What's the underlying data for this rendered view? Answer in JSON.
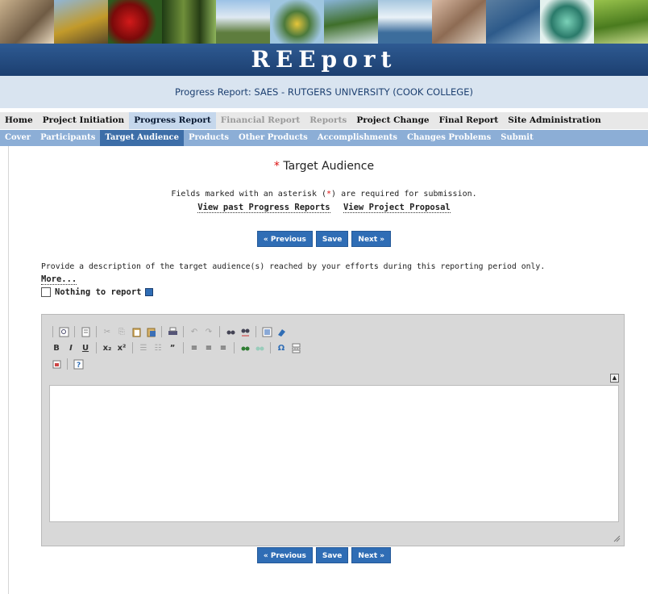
{
  "site": {
    "brand": "REEport",
    "subtitle": "Progress Report: SAES - RUTGERS UNIVERSITY (COOK COLLEGE)"
  },
  "nav": {
    "tabs": [
      {
        "label": "Home",
        "state": "normal"
      },
      {
        "label": "Project Initiation",
        "state": "normal"
      },
      {
        "label": "Progress Report",
        "state": "active"
      },
      {
        "label": "Financial Report",
        "state": "disabled"
      },
      {
        "label": "Reports",
        "state": "disabled"
      },
      {
        "label": "Project Change",
        "state": "normal"
      },
      {
        "label": "Final Report",
        "state": "normal"
      },
      {
        "label": "Site Administration",
        "state": "normal"
      }
    ],
    "subtabs": [
      {
        "label": "Cover",
        "state": "normal"
      },
      {
        "label": "Participants",
        "state": "normal"
      },
      {
        "label": "Target Audience",
        "state": "active"
      },
      {
        "label": "Products",
        "state": "normal"
      },
      {
        "label": "Other Products",
        "state": "normal"
      },
      {
        "label": "Accomplishments",
        "state": "normal"
      },
      {
        "label": "Changes Problems",
        "state": "normal"
      },
      {
        "label": "Submit",
        "state": "normal"
      }
    ]
  },
  "page": {
    "required_mark": "*",
    "title": "Target Audience",
    "note_prefix": "Fields marked with an asterisk (",
    "note_mark": "*",
    "note_suffix": ") are required for submission.",
    "link_past": "View past Progress Reports",
    "link_proposal": "View Project Proposal",
    "btn_previous": "« Previous",
    "btn_save": "Save",
    "btn_next": "Next »",
    "description": "Provide a description of the target audience(s) reached by your efforts during this reporting period only.",
    "more_label": "More...",
    "nothing_label": "Nothing to report",
    "nothing_checked": false
  },
  "editor": {
    "toolbar_row1": [
      "source-icon",
      "preview-icon",
      "cut-icon",
      "copy-icon",
      "paste-icon",
      "paste-word-icon",
      "print-icon",
      "undo-icon",
      "redo-icon",
      "find-icon",
      "replace-icon",
      "select-all-icon",
      "remove-format-icon"
    ],
    "toolbar_row2": [
      "bold-icon",
      "italic-icon",
      "underline-icon",
      "subscript-icon",
      "superscript-icon",
      "numbered-list-icon",
      "bulleted-list-icon",
      "blockquote-icon",
      "align-left-icon",
      "align-center-icon",
      "align-right-icon",
      "spellcheck-icon",
      "spellcheck-as-you-type-icon",
      "special-char-icon",
      "page-break-icon"
    ],
    "toolbar_row3": [
      "show-blocks-icon",
      "about-icon"
    ],
    "content": ""
  }
}
